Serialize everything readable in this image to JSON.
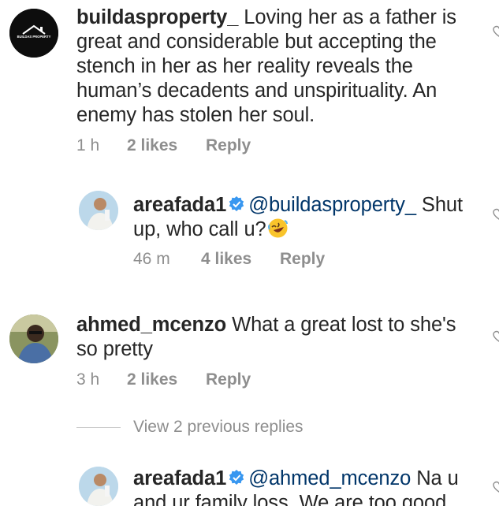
{
  "comments": [
    {
      "username": "buildasproperty_",
      "text": "Loving her as a father is great and considerable but accepting the stench in her as her reality reveals the human’s decadents and unspirituality. An enemy has stolen her soul.",
      "time": "1 h",
      "likes": "2 likes",
      "reply": "Reply",
      "avatar_icon": "building-logo-icon",
      "avatar_logo_text": "BUILDAS PROPERTY"
    },
    {
      "username": "areafada1",
      "verified": true,
      "mention": "@buildasproperty_",
      "text": "Shut up, who call u?",
      "emoji": "rolling-on-floor-laughing-emoji",
      "time": "46 m",
      "likes": "4 likes",
      "reply": "Reply"
    },
    {
      "username": "ahmed_mcenzo",
      "text": "What a great lost to she's so pretty",
      "time": "3 h",
      "likes": "2 likes",
      "reply": "Reply"
    },
    {
      "username": "areafada1",
      "verified": true,
      "mention": "@ahmed_mcenzo",
      "text": "Na u and ur family loss. We are too good"
    }
  ],
  "view_previous_replies": "View 2 previous replies",
  "colors": {
    "text": "#262626",
    "meta": "#8e8e8e",
    "mention": "#003569",
    "verified": "#3897f0"
  }
}
